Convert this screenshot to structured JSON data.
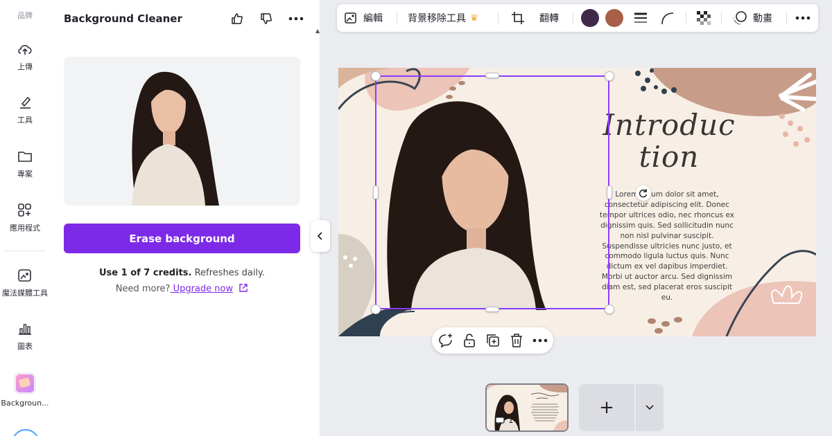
{
  "rail": {
    "top_label": "品牌",
    "items": [
      {
        "label": "上傳",
        "icon": "upload-cloud-icon"
      },
      {
        "label": "工具",
        "icon": "pen-tool-icon"
      },
      {
        "label": "專案",
        "icon": "folder-icon"
      },
      {
        "label": "應用程式",
        "icon": "apps-grid-icon"
      },
      {
        "label": "魔法媒體工具",
        "icon": "magic-media-icon"
      },
      {
        "label": "圖表",
        "icon": "chart-icon"
      },
      {
        "label": "Backgroun...",
        "icon": "background-app-icon"
      }
    ]
  },
  "panel": {
    "title": "Background Cleaner",
    "erase_label": "Erase background",
    "credits_bold": "Use 1 of 7 credits.",
    "credits_rest": " Refreshes daily.",
    "need_more": "Need more?",
    "upgrade": " Upgrade now"
  },
  "toolbar": {
    "edit": "編輯",
    "bg_remover": "背景移除工具",
    "flip": "翻轉",
    "animate": "動畫",
    "swatches": [
      "#3f2a4a",
      "#a85f47"
    ]
  },
  "slide": {
    "title_line1": "Introduc",
    "title_line2": "tion",
    "body": "Lorem ipsum dolor sit amet, consectetur adipiscing elit. Donec tempor ultrices odio, nec rhoncus ex dignissim quis. Sed sollicitudin nunc non nisl pulvinar suscipit. Suspendisse ultricies nunc justo, et commodo ligula luctus quis. Nunc dictum ex vel dapibus imperdiet. Morbi ut auctor arcu. Sed dignissim diam est, sed placerat eros suscipit eu."
  },
  "pages": {
    "current": "1",
    "add_label": "+"
  },
  "colors": {
    "accent": "#7d2ae8",
    "selection": "#8b3dff",
    "slide_bg": "#f7efe6"
  }
}
